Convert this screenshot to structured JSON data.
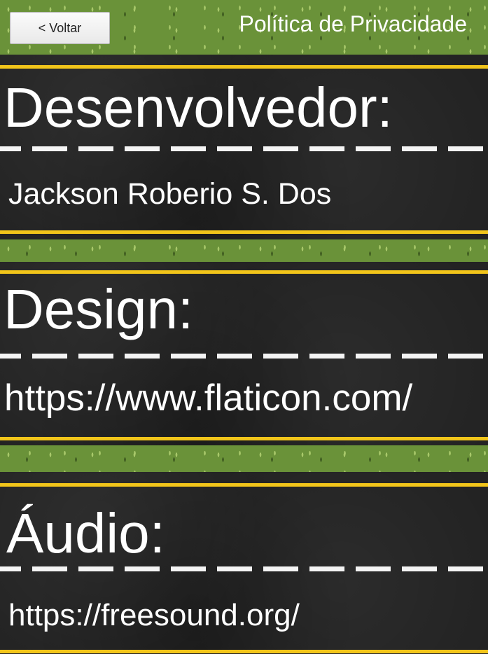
{
  "header": {
    "back_label": "< Voltar",
    "title": "Política de Privacidade"
  },
  "sections": [
    {
      "title": "Desenvolvedor:",
      "value": "Jackson Roberio S. Dos"
    },
    {
      "title": "Design:",
      "value": "https://www.flaticon.com/"
    },
    {
      "title": "Áudio:",
      "value": "https://freesound.org/"
    }
  ],
  "colors": {
    "grass": "#6a9239",
    "road": "#232323",
    "road_edge_line": "#f2c51a",
    "lane_dash": "#f4f4f4",
    "text": "#ffffff"
  }
}
